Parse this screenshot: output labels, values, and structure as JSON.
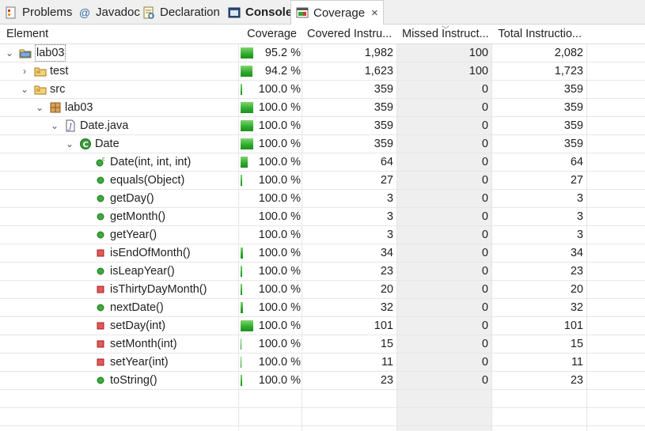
{
  "tabs": [
    {
      "label": "Problems",
      "icon": "problems-icon"
    },
    {
      "label": "Javadoc",
      "icon": "javadoc-icon"
    },
    {
      "label": "Declaration",
      "icon": "declaration-icon"
    },
    {
      "label": "Console",
      "icon": "console-icon"
    },
    {
      "label": "Coverage",
      "icon": "coverage-icon",
      "close": "×"
    }
  ],
  "columns": [
    "Element",
    "Coverage",
    "Covered Instru...",
    "Missed Instruct...",
    "Total Instructio..."
  ],
  "rows": [
    {
      "element": "lab03",
      "kind": "project",
      "coverage": "95.2 %",
      "covered": "1,982",
      "missed": "100",
      "total": "2,082",
      "fraction": 0.952
    },
    {
      "element": "test",
      "kind": "folder",
      "coverage": "94.2 %",
      "covered": "1,623",
      "missed": "100",
      "total": "1,723",
      "fraction": 0.942
    },
    {
      "element": "src",
      "kind": "folder",
      "coverage": "100.0 %",
      "covered": "359",
      "missed": "0",
      "total": "359",
      "fraction": 1.0
    },
    {
      "element": "lab03",
      "kind": "package",
      "coverage": "100.0 %",
      "covered": "359",
      "missed": "0",
      "total": "359",
      "fraction": 1.0
    },
    {
      "element": "Date.java",
      "kind": "file",
      "coverage": "100.0 %",
      "covered": "359",
      "missed": "0",
      "total": "359",
      "fraction": 1.0
    },
    {
      "element": "Date",
      "kind": "class",
      "coverage": "100.0 %",
      "covered": "359",
      "missed": "0",
      "total": "359",
      "fraction": 1.0
    },
    {
      "element": "Date(int, int, int)",
      "kind": "constructor",
      "coverage": "100.0 %",
      "covered": "64",
      "missed": "0",
      "total": "64",
      "fraction": 1.0
    },
    {
      "element": "equals(Object)",
      "kind": "public-method",
      "coverage": "100.0 %",
      "covered": "27",
      "missed": "0",
      "total": "27",
      "fraction": 1.0
    },
    {
      "element": "getDay()",
      "kind": "public-method",
      "coverage": "100.0 %",
      "covered": "3",
      "missed": "0",
      "total": "3",
      "fraction": 1.0
    },
    {
      "element": "getMonth()",
      "kind": "public-method",
      "coverage": "100.0 %",
      "covered": "3",
      "missed": "0",
      "total": "3",
      "fraction": 1.0
    },
    {
      "element": "getYear()",
      "kind": "public-method",
      "coverage": "100.0 %",
      "covered": "3",
      "missed": "0",
      "total": "3",
      "fraction": 1.0
    },
    {
      "element": "isEndOfMonth()",
      "kind": "private-method",
      "coverage": "100.0 %",
      "covered": "34",
      "missed": "0",
      "total": "34",
      "fraction": 1.0
    },
    {
      "element": "isLeapYear()",
      "kind": "public-method",
      "coverage": "100.0 %",
      "covered": "23",
      "missed": "0",
      "total": "23",
      "fraction": 1.0
    },
    {
      "element": "isThirtyDayMonth()",
      "kind": "private-method",
      "coverage": "100.0 %",
      "covered": "20",
      "missed": "0",
      "total": "20",
      "fraction": 1.0
    },
    {
      "element": "nextDate()",
      "kind": "public-method",
      "coverage": "100.0 %",
      "covered": "32",
      "missed": "0",
      "total": "32",
      "fraction": 1.0
    },
    {
      "element": "setDay(int)",
      "kind": "private-method",
      "coverage": "100.0 %",
      "covered": "101",
      "missed": "0",
      "total": "101",
      "fraction": 1.0
    },
    {
      "element": "setMonth(int)",
      "kind": "private-method",
      "coverage": "100.0 %",
      "covered": "15",
      "missed": "0",
      "total": "15",
      "fraction": 1.0
    },
    {
      "element": "setYear(int)",
      "kind": "private-method",
      "coverage": "100.0 %",
      "covered": "11",
      "missed": "0",
      "total": "11",
      "fraction": 1.0
    },
    {
      "element": "toString()",
      "kind": "public-method",
      "coverage": "100.0 %",
      "covered": "23",
      "missed": "0",
      "total": "23",
      "fraction": 1.0
    }
  ],
  "colors": {
    "covered": "#2eaa2e",
    "missed": "#e03030",
    "header_bg": "#f0f0f0",
    "missed_column_bg": "#efefef"
  }
}
